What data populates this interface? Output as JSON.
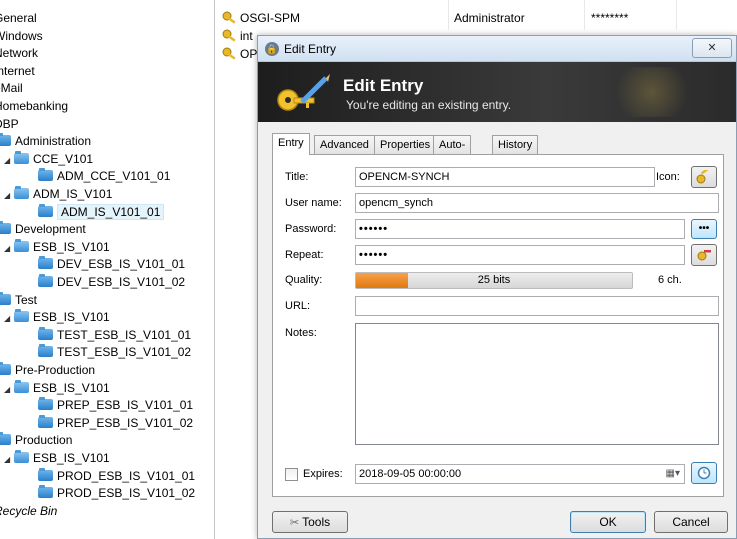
{
  "tree": {
    "items": [
      {
        "label": "General",
        "indent": 0,
        "icon": false,
        "arrow": ""
      },
      {
        "label": "Windows",
        "indent": 0,
        "icon": false,
        "arrow": ""
      },
      {
        "label": "Network",
        "indent": 0,
        "icon": false,
        "arrow": ""
      },
      {
        "label": "Internet",
        "indent": 0,
        "icon": false,
        "arrow": ""
      },
      {
        "label": "eMail",
        "indent": 0,
        "icon": false,
        "arrow": ""
      },
      {
        "label": "Homebanking",
        "indent": 0,
        "icon": false,
        "arrow": ""
      },
      {
        "label": "DBP",
        "indent": 0,
        "icon": false,
        "arrow": ""
      },
      {
        "label": "Administration",
        "indent": 0,
        "icon": true,
        "arrow": ""
      },
      {
        "label": "CCE_V101",
        "indent": 1,
        "icon": true,
        "arrow": "◢"
      },
      {
        "label": "ADM_CCE_V101_01",
        "indent": 2,
        "icon": true,
        "arrow": ""
      },
      {
        "label": "ADM_IS_V101",
        "indent": 1,
        "icon": true,
        "arrow": "◢"
      },
      {
        "label": "ADM_IS_V101_01",
        "indent": 2,
        "icon": true,
        "arrow": "",
        "selected": true
      },
      {
        "label": "Development",
        "indent": 0,
        "icon": true,
        "arrow": ""
      },
      {
        "label": "ESB_IS_V101",
        "indent": 1,
        "icon": true,
        "arrow": "◢"
      },
      {
        "label": "DEV_ESB_IS_V101_01",
        "indent": 2,
        "icon": true,
        "arrow": ""
      },
      {
        "label": "DEV_ESB_IS_V101_02",
        "indent": 2,
        "icon": true,
        "arrow": ""
      },
      {
        "label": "Test",
        "indent": 0,
        "icon": true,
        "arrow": ""
      },
      {
        "label": "ESB_IS_V101",
        "indent": 1,
        "icon": true,
        "arrow": "◢"
      },
      {
        "label": "TEST_ESB_IS_V101_01",
        "indent": 2,
        "icon": true,
        "arrow": ""
      },
      {
        "label": "TEST_ESB_IS_V101_02",
        "indent": 2,
        "icon": true,
        "arrow": ""
      },
      {
        "label": "Pre-Production",
        "indent": 0,
        "icon": true,
        "arrow": ""
      },
      {
        "label": "ESB_IS_V101",
        "indent": 1,
        "icon": true,
        "arrow": "◢"
      },
      {
        "label": "PREP_ESB_IS_V101_01",
        "indent": 2,
        "icon": true,
        "arrow": ""
      },
      {
        "label": "PREP_ESB_IS_V101_02",
        "indent": 2,
        "icon": true,
        "arrow": ""
      },
      {
        "label": "Production",
        "indent": 0,
        "icon": true,
        "arrow": ""
      },
      {
        "label": "ESB_IS_V101",
        "indent": 1,
        "icon": true,
        "arrow": "◢"
      },
      {
        "label": "PROD_ESB_IS_V101_01",
        "indent": 2,
        "icon": true,
        "arrow": ""
      },
      {
        "label": "PROD_ESB_IS_V101_02",
        "indent": 2,
        "icon": true,
        "arrow": ""
      },
      {
        "label": "Recycle Bin",
        "indent": 0,
        "icon": false,
        "arrow": "",
        "italic": true
      }
    ]
  },
  "entries": [
    {
      "title": "OSGI-SPM",
      "user": "Administrator",
      "password": "********"
    },
    {
      "title": "int",
      "user": "",
      "password": ""
    },
    {
      "title": "OP",
      "user": "",
      "password": ""
    }
  ],
  "dialog": {
    "window_title": "Edit Entry",
    "close_glyph": "✕",
    "banner_title": "Edit Entry",
    "banner_subtitle": "You're editing an existing entry.",
    "tabs": [
      "Entry",
      "Advanced",
      "Properties",
      "Auto-Type",
      "History"
    ],
    "active_tab": "Entry",
    "labels": {
      "title": "Title:",
      "icon": "Icon:",
      "username": "User name:",
      "password": "Password:",
      "repeat": "Repeat:",
      "quality": "Quality:",
      "url": "URL:",
      "notes": "Notes:",
      "expires": "Expires:"
    },
    "values": {
      "title": "OPENCM-SYNCH",
      "username": "opencm_synch",
      "password": "••••••",
      "repeat": "••••••",
      "url": "",
      "notes": "",
      "expires": "2018-09-05 00:00:00"
    },
    "quality": {
      "text": "25 bits",
      "chars": "6 ch.",
      "fill_fraction": 0.19
    },
    "reveal_glyph": "•••",
    "buttons": {
      "tools": "Tools",
      "ok": "OK",
      "cancel": "Cancel"
    }
  },
  "colors": {
    "accent": "#3c7fb1",
    "quality_fill": "#e07a10",
    "folder": "#2a7fc9"
  }
}
